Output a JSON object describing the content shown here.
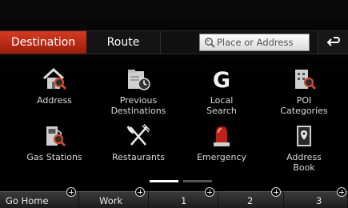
{
  "tabs": {
    "destination_label": "Destination",
    "route_label": "Route"
  },
  "search": {
    "placeholder": "Place or Address",
    "icon": "search-icon"
  },
  "back": {
    "icon": "back-arrow-icon"
  },
  "menu": [
    {
      "label_line1": "Address",
      "label_line2": "",
      "icon": "house-search-icon"
    },
    {
      "label_line1": "Previous",
      "label_line2": "Destinations",
      "icon": "folder-clock-icon"
    },
    {
      "label_line1": "Local",
      "label_line2": "Search",
      "icon": "google-g-icon"
    },
    {
      "label_line1": "POI",
      "label_line2": "Categories",
      "icon": "building-search-icon"
    },
    {
      "label_line1": "Gas Stations",
      "label_line2": "",
      "icon": "gas-pump-icon"
    },
    {
      "label_line1": "Restaurants",
      "label_line2": "",
      "icon": "fork-knife-icon"
    },
    {
      "label_line1": "Emergency",
      "label_line2": "",
      "icon": "siren-icon"
    },
    {
      "label_line1": "Address",
      "label_line2": "Book",
      "icon": "address-book-icon"
    }
  ],
  "pager": {
    "pages": 2,
    "current": 1
  },
  "favorites": [
    {
      "label": "Go Home"
    },
    {
      "label": "Work"
    },
    {
      "label": "1"
    },
    {
      "label": "2"
    },
    {
      "label": "3"
    }
  ],
  "colors": {
    "accent": "#c22a15",
    "background": "#000000",
    "text": "#e8e8e8"
  }
}
